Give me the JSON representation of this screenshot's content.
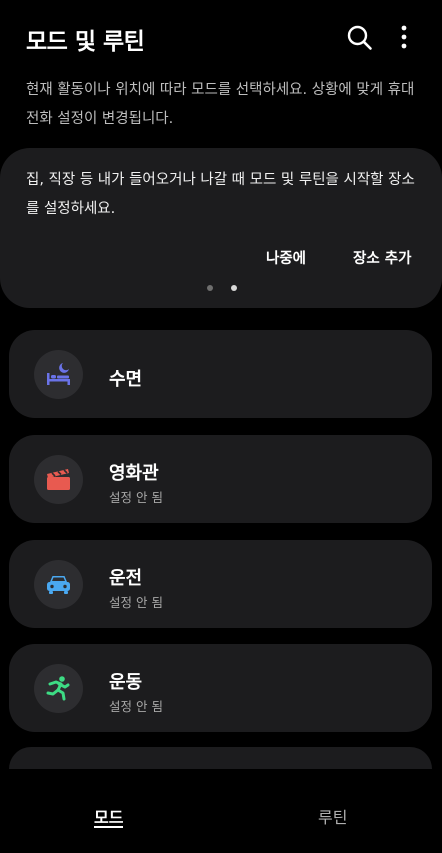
{
  "header": {
    "title": "모드 및 루틴"
  },
  "description": "현재 활동이나 위치에 따라 모드를 선택하세요. 상황에 맞게 휴대전화 설정이 변경됩니다.",
  "place_card": {
    "message": "집, 직장 등 내가 들어오거나 나갈 때 모드 및 루틴을 시작할 장소를 설정하세요.",
    "later_label": "나중에",
    "add_label": "장소 추가"
  },
  "modes": [
    {
      "name": "수면",
      "status": ""
    },
    {
      "name": "영화관",
      "status": "설정 안 됨"
    },
    {
      "name": "운전",
      "status": "설정 안 됨"
    },
    {
      "name": "운동",
      "status": "설정 안 됨"
    }
  ],
  "icons": {
    "sleep": "bed-moon-icon",
    "movie": "clapperboard-icon",
    "driving": "car-icon",
    "exercise": "running-person-icon"
  },
  "colors": {
    "sleep": "#6a73e8",
    "movie": "#e85a50",
    "driving": "#4aa8f0",
    "exercise": "#3ddc84"
  },
  "bottom_nav": {
    "tab_mode": "모드",
    "tab_routine": "루틴",
    "selected": "모드"
  }
}
